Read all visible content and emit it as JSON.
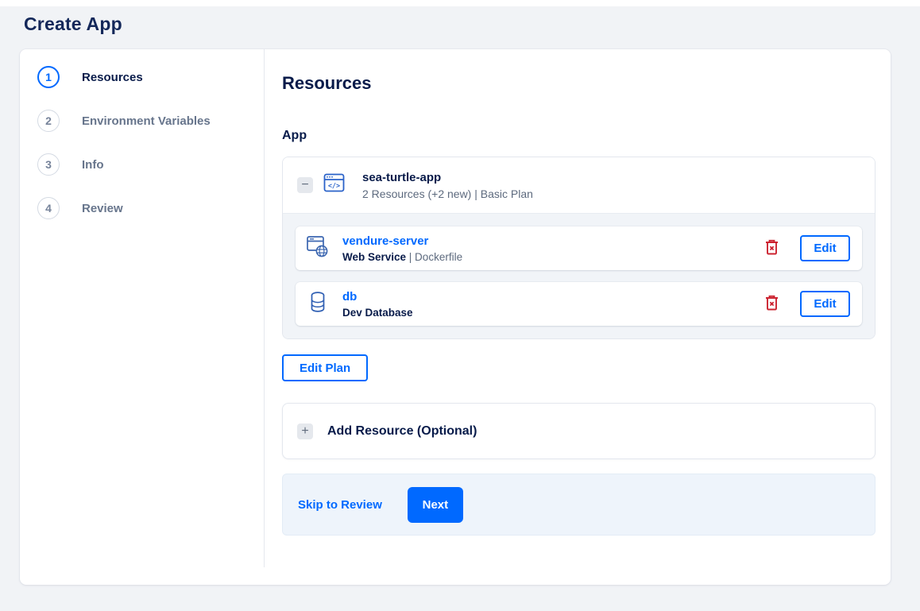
{
  "page": {
    "title": "Create App"
  },
  "colors": {
    "accent_blue": "#0069ff",
    "navy_text": "#081b4a",
    "muted_text": "#5d6a7e",
    "danger_red": "#cc2330",
    "page_bg": "#f1f3f6",
    "panel_bg": "#f1f4f8",
    "footer_bg": "#eef4fb"
  },
  "stepper": {
    "steps": [
      {
        "number": "1",
        "label": "Resources",
        "active": true
      },
      {
        "number": "2",
        "label": "Environment Variables",
        "active": false
      },
      {
        "number": "3",
        "label": "Info",
        "active": false
      },
      {
        "number": "4",
        "label": "Review",
        "active": false
      }
    ]
  },
  "content": {
    "heading": "Resources",
    "section_label": "App",
    "app": {
      "name": "sea-turtle-app",
      "meta": "2 Resources (+2 new) | Basic Plan",
      "collapse_glyph": "−",
      "resources": [
        {
          "name": "vendure-server",
          "type": "Web Service",
          "source": " | Dockerfile",
          "edit_label": "Edit",
          "icon": "web-service-icon"
        },
        {
          "name": "db",
          "type": "Dev Database",
          "source": "",
          "edit_label": "Edit",
          "icon": "database-icon"
        }
      ]
    },
    "edit_plan_label": "Edit Plan",
    "add_resource": {
      "label": "Add Resource (Optional)",
      "plus_glyph": "+"
    },
    "footer": {
      "skip_label": "Skip to Review",
      "next_label": "Next"
    }
  }
}
